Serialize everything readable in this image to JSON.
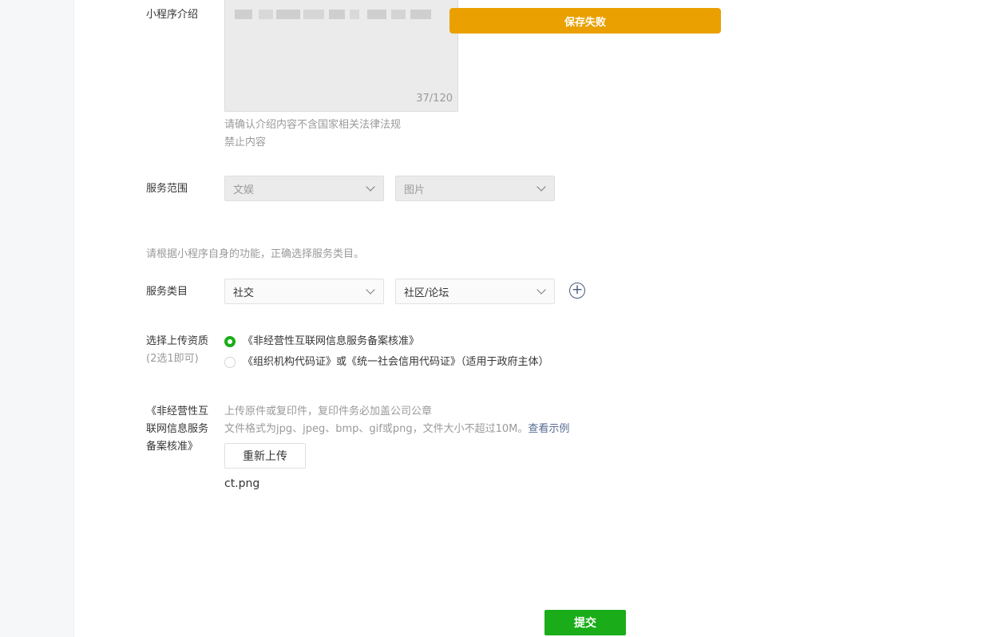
{
  "intro": {
    "label": "小程序介绍",
    "counter": "37/120",
    "hint_line1": "请确认介绍内容不含国家相关法律法规",
    "hint_line2": "禁止内容"
  },
  "toast": {
    "message": "保存失败",
    "color": "#eaa000"
  },
  "service_scope": {
    "label": "服务范围",
    "select1_value": "文娱",
    "select2_value": "图片"
  },
  "category_hint": "请根据小程序自身的功能，正确选择服务类目。",
  "service_category": {
    "label": "服务类目",
    "select1_value": "社交",
    "select2_value": "社区/论坛",
    "add_icon": "plus-circle-icon"
  },
  "qualification": {
    "label_line1": "选择上传资质",
    "label_line2": "(2选1即可)",
    "option1": "《非经营性互联网信息服务备案核准》",
    "option2": "《组织机构代码证》或《统一社会信用代码证》（适用于政府主体）",
    "selected_index": 0
  },
  "upload": {
    "label_line1": "《非经营性互",
    "label_line2": "联网信息服务",
    "label_line3": "备案核准》",
    "hint_line1": "上传原件或复印件，复印件务必加盖公司公章",
    "hint_line2": "文件格式为jpg、jpeg、bmp、gif或png，文件大小不超过10M。",
    "example_link": "查看示例",
    "reupload_label": "重新上传",
    "file_name": "ct.png"
  },
  "submit_label": "提交",
  "colors": {
    "accent_green": "#1aad19",
    "link_blue": "#576b95",
    "warning": "#eaa000"
  }
}
